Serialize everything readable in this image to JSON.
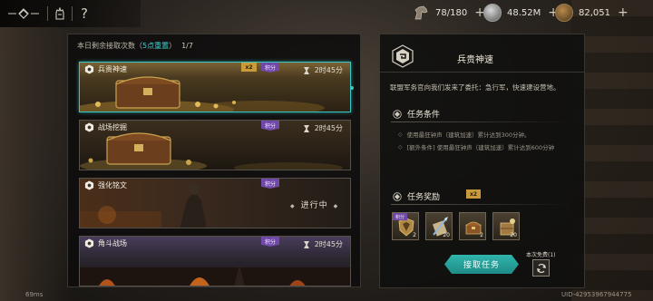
{
  "resources": [
    {
      "name": "stamina",
      "icon": "horse-head-icon",
      "value": "78/180"
    },
    {
      "name": "silver",
      "icon": "silver-coin-icon",
      "value": "48.52M"
    },
    {
      "name": "gold",
      "icon": "gold-coin-icon",
      "value": "82,051"
    }
  ],
  "topbar": {
    "help_label": "?"
  },
  "task_list": {
    "remaining_label": "本日剩余接取次数（",
    "reset_highlight": "5点重置",
    "remaining_close": "）",
    "count": "1/7"
  },
  "tasks": [
    {
      "name": "兵贵神速",
      "time": "2时45分",
      "points_label": "积分",
      "multiplier": "x2",
      "selected": true,
      "status": ""
    },
    {
      "name": "战场挖掘",
      "time": "2时45分",
      "points_label": "积分",
      "multiplier": "",
      "selected": false,
      "status": ""
    },
    {
      "name": "强化铭文",
      "time": "",
      "points_label": "积分",
      "multiplier": "",
      "selected": false,
      "status": "进行中"
    },
    {
      "name": "角斗战场",
      "time": "2时45分",
      "points_label": "积分",
      "multiplier": "",
      "selected": false,
      "status": ""
    }
  ],
  "detail": {
    "title": "兵贵神速",
    "description": "联盟军务官向我们发来了委托：急行军，快速建设营地。",
    "conditions_title": "任务条件",
    "conditions": [
      "使用最狂钟声（建筑加速）累计达到300分钟。",
      "[额外条件] 使用最狂钟声（建筑加速）累计达到600分钟"
    ],
    "rewards_title": "任务奖励",
    "rewards_multiplier": "x2",
    "rewards": [
      {
        "icon": "shield-emblem-icon",
        "qty": "2",
        "points_label": "积分"
      },
      {
        "icon": "quill-scroll-icon",
        "qty": "20",
        "points_label": ""
      },
      {
        "icon": "treasure-chest-icon",
        "qty": "2",
        "points_label": ""
      },
      {
        "icon": "supply-crate-icon",
        "qty": "20",
        "points_label": ""
      }
    ],
    "accept_label": "接取任务",
    "free_label": "本次免费(1)"
  },
  "footer": {
    "ping": "69ms",
    "uid": "UID-42953967944775"
  },
  "colors": {
    "accent": "#39c7c4",
    "points_badge": "#7048a8",
    "multiplier_badge": "#c89a3a"
  }
}
